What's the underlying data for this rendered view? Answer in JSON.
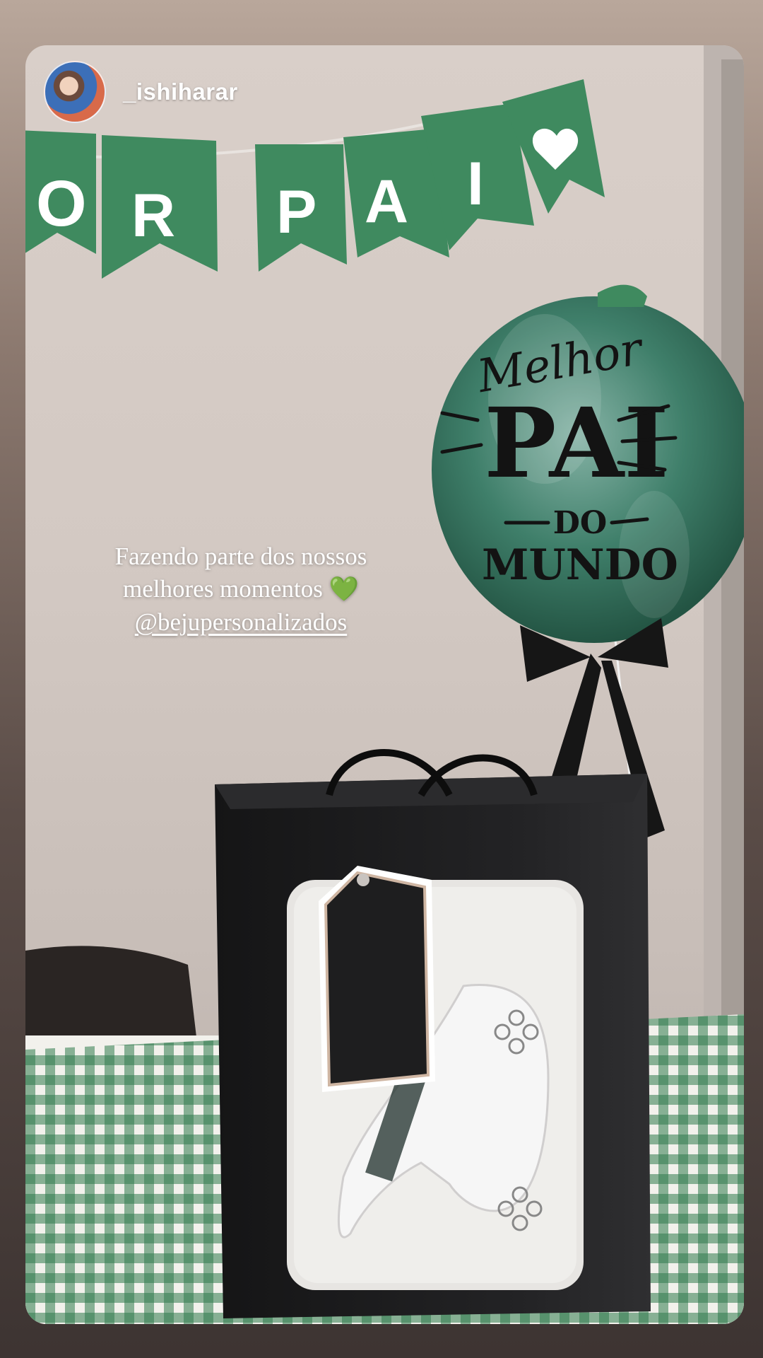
{
  "story": {
    "username": "_ishiharar",
    "caption_line1": "Fazendo parte dos nossos",
    "caption_line2": "melhores momentos",
    "caption_emoji": "💚",
    "mention": "@bejupersonalizados"
  },
  "photo": {
    "banner_letters": [
      "O",
      "R",
      "P",
      "A",
      "I"
    ],
    "balloon_line1": "Melhor",
    "balloon_line2": "PAI",
    "balloon_line3": "DO",
    "balloon_line4": "MUNDO",
    "colors": {
      "banner_green": "#3f8a5f",
      "balloon_green": "#3f7f6a",
      "bag_black": "#1b1b1c",
      "checker_green": "#2f7a4d"
    }
  }
}
